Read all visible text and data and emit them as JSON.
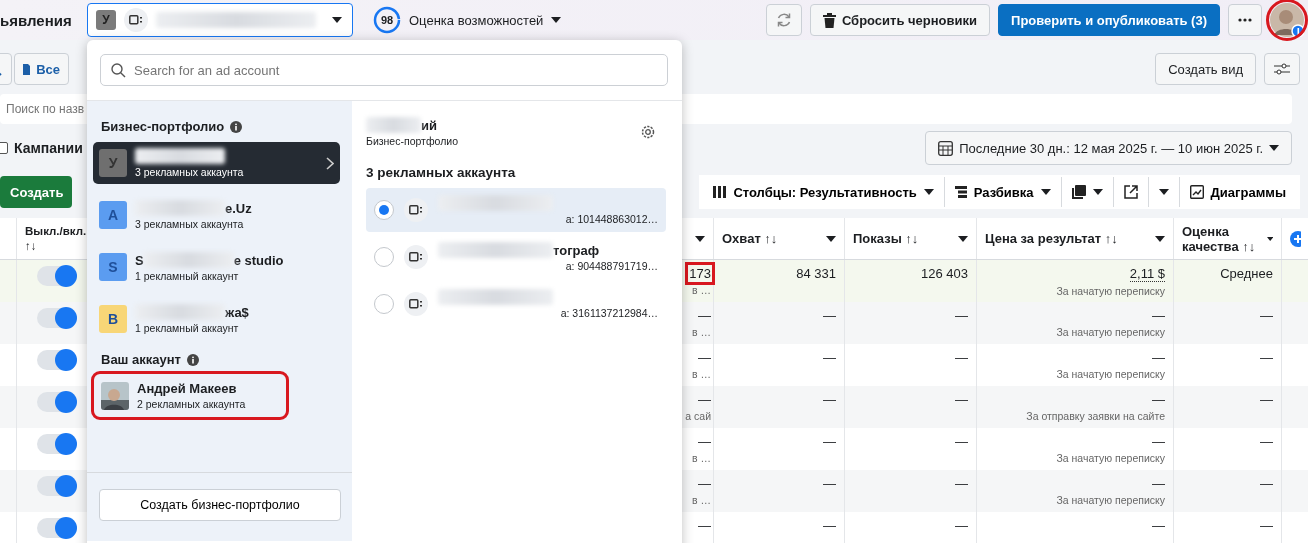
{
  "header": {
    "title": "ьявления",
    "account_selector": {
      "initial": "У"
    },
    "score": {
      "value": "98",
      "label": "Оценка возможностей"
    },
    "buttons": [
      {
        "kind": "refresh"
      },
      {
        "kind": "secondary",
        "label": "Сбросить черновики"
      },
      {
        "kind": "primary",
        "label": "Проверить и опубликовать (3)"
      },
      {
        "kind": "more"
      }
    ],
    "profile": {
      "highlighted": true
    }
  },
  "toolbar": {
    "all_button": "Все",
    "create_view": "Создать вид"
  },
  "search": {
    "placeholder": "Поиск по назв"
  },
  "campaigns": {
    "label": "Кампании",
    "checked": false
  },
  "date_range": "Последние 30 дн.: 12 мая 2025 г. — 10 июн 2025 г.",
  "create_button": "Создать",
  "view_tools": [
    {
      "kind": "columns",
      "label": "Столбцы: Результативность"
    },
    {
      "kind": "breakdown",
      "label": "Разбивка"
    },
    {
      "kind": "reports"
    },
    {
      "kind": "export"
    },
    {
      "kind": "caret"
    },
    {
      "kind": "charts",
      "label": "Диаграммы"
    }
  ],
  "table": {
    "toggle_column": "Выкл./вкл. ↑↓",
    "columns": [
      {
        "label": "Охват ↑↓"
      },
      {
        "label": "Показы ↑↓"
      },
      {
        "label": "Цена за результат ↑↓"
      },
      {
        "label": "Оценка качества ↑↓"
      }
    ],
    "rows": [
      {
        "on": true,
        "edited": true,
        "column_3": "173",
        "column_3_highlighted": true,
        "column_3_note": "в …",
        "reach": "84 331",
        "impressions": "126 403",
        "cost": "2,11 $",
        "cost_note": "За начатую переписку",
        "quality": "Среднее"
      },
      {
        "on": true,
        "edited": false,
        "column_3": "—",
        "column_3_highlighted": false,
        "column_3_note": "в …",
        "reach": "—",
        "impressions": "—",
        "cost": "—",
        "cost_note": "За начатую переписку",
        "quality": "—"
      },
      {
        "on": true,
        "edited": false,
        "column_3": "—",
        "column_3_highlighted": false,
        "column_3_note": "в …",
        "reach": "—",
        "impressions": "—",
        "cost": "—",
        "cost_note": "За начатую переписку",
        "quality": "—"
      },
      {
        "on": true,
        "edited": false,
        "column_3": "—",
        "column_3_highlighted": false,
        "column_3_note": "а сай",
        "reach": "—",
        "impressions": "—",
        "cost": "—",
        "cost_note": "За отправку заявки на сайте",
        "quality": "—"
      },
      {
        "on": true,
        "edited": false,
        "column_3": "—",
        "column_3_highlighted": false,
        "column_3_note": "в …",
        "reach": "—",
        "impressions": "—",
        "cost": "—",
        "cost_note": "За начатую переписку",
        "quality": "—"
      },
      {
        "on": true,
        "edited": false,
        "column_3": "—",
        "column_3_highlighted": false,
        "column_3_note": "в …",
        "reach": "—",
        "impressions": "—",
        "cost": "—",
        "cost_note": "За начатую переписку",
        "quality": "—"
      },
      {
        "on": true,
        "edited": false,
        "column_3": "—",
        "column_3_highlighted": false,
        "reach": "—",
        "impressions": "—",
        "cost": "—",
        "quality": "—"
      }
    ]
  },
  "account_menu": {
    "search_placeholder": "Search for an ad account",
    "portfolios_heading": "Бизнес-портфолио",
    "portfolios": [
      {
        "initial": "У",
        "color": "#6f6f6f",
        "name_parts": [
          {
            "kind": "blur"
          }
        ],
        "count": "3 рекламных аккаунта",
        "selected": true
      },
      {
        "initial": "A",
        "color": "#5b9cf0",
        "name_parts": [
          {
            "kind": "blur"
          },
          {
            "kind": "text",
            "text": "e.Uz"
          }
        ],
        "count": "3 рекламных аккаунта",
        "selected": false
      },
      {
        "initial": "S",
        "color": "#5b9cf0",
        "name_parts": [
          {
            "kind": "text",
            "text": "S"
          },
          {
            "kind": "blur"
          },
          {
            "kind": "text",
            "text": "e studio"
          }
        ],
        "count": "1 рекламный аккаунт",
        "selected": false
      },
      {
        "initial": "B",
        "color": "#f8d677",
        "name_parts": [
          {
            "kind": "blur"
          },
          {
            "kind": "text",
            "text": "жа$"
          }
        ],
        "count": "1 рекламный аккаунт",
        "selected": false
      }
    ],
    "your_account_heading": "Ваш аккаунт",
    "your_account": {
      "name": "Андрей Макеев",
      "count": "2 рекламных аккаунта",
      "highlighted": true
    },
    "create_portfolio": "Создать бизнес-портфолио",
    "detail": {
      "name_parts": [
        {
          "kind": "blur"
        },
        {
          "kind": "text",
          "text": "ий"
        }
      ],
      "subtitle": "Бизнес-портфолио",
      "accounts_heading": "3 рекламных аккаунта",
      "accounts": [
        {
          "selected": true,
          "name_parts": [
            {
              "kind": "blur"
            }
          ],
          "id": "а: 101448863012…"
        },
        {
          "selected": false,
          "name_parts": [
            {
              "kind": "blur"
            },
            {
              "kind": "text",
              "text": "тограф"
            }
          ],
          "id": "а: 904488791719…"
        },
        {
          "selected": false,
          "name_parts": [
            {
              "kind": "blur"
            }
          ],
          "id": "а: 3161137212984…"
        }
      ]
    }
  }
}
